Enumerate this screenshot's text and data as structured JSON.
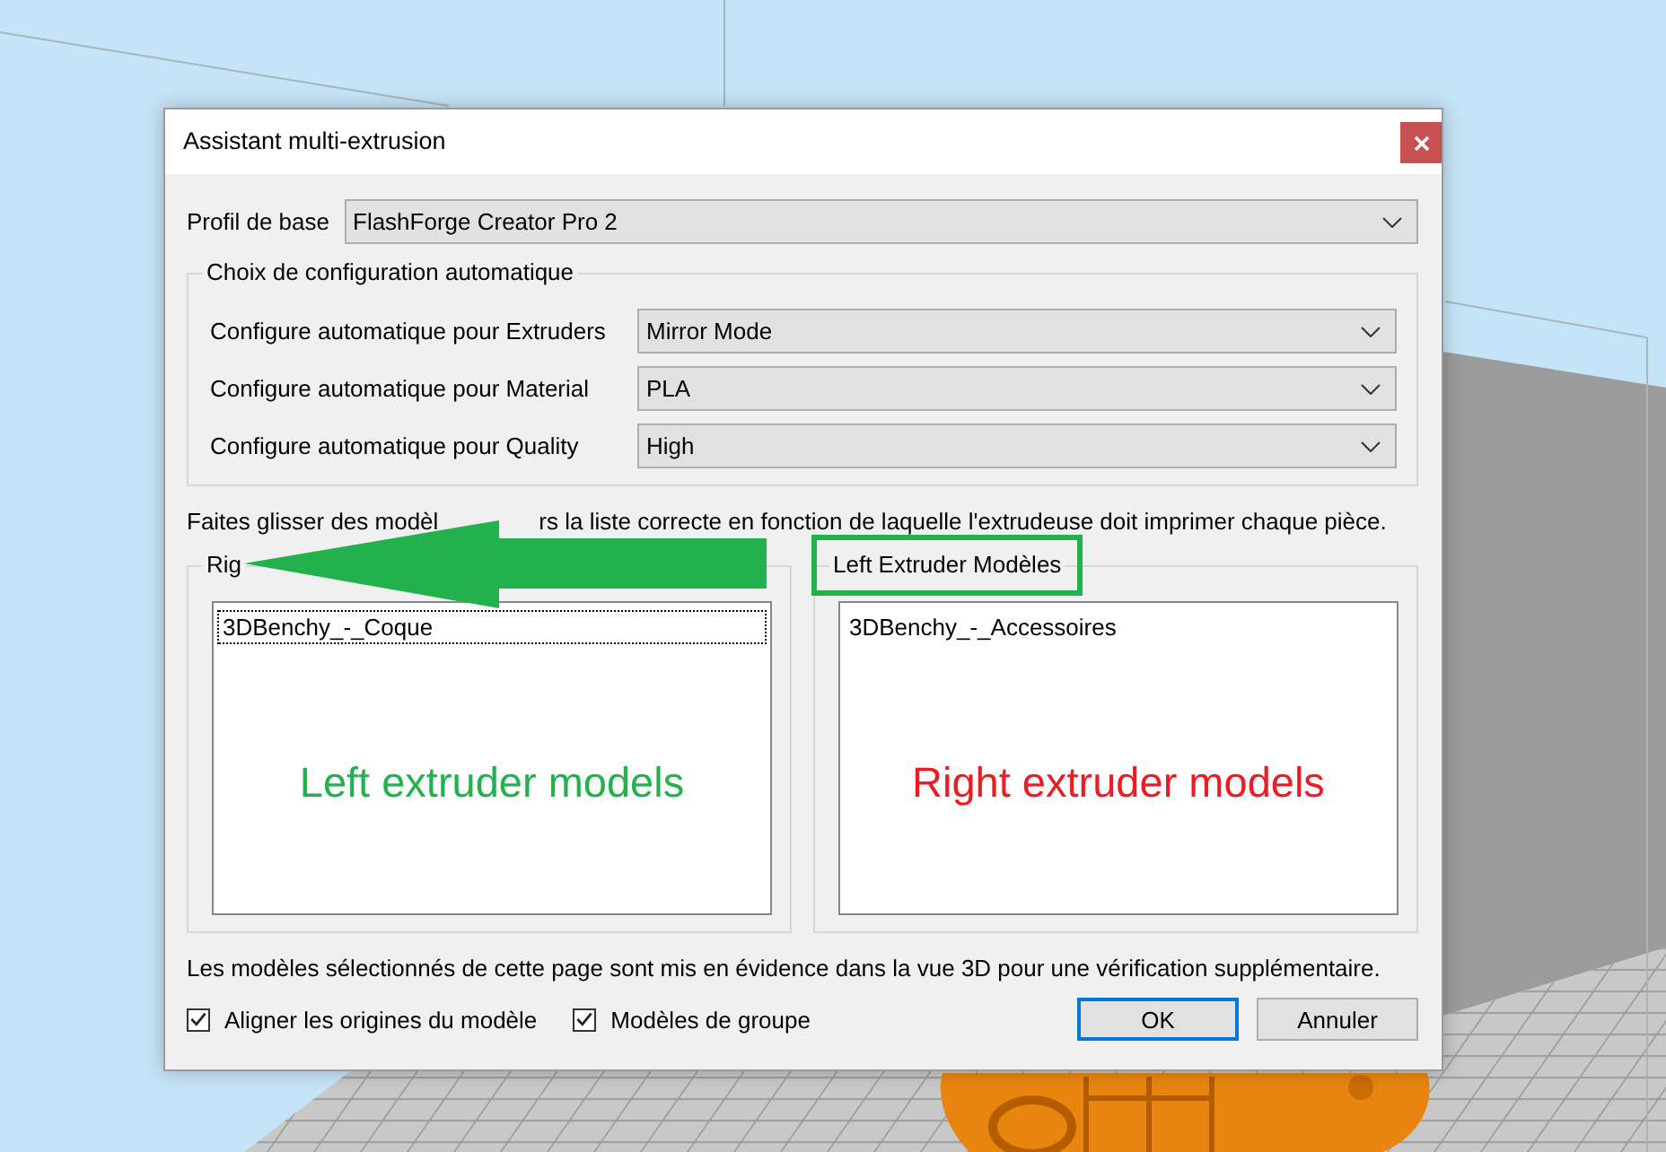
{
  "window": {
    "title": "Assistant multi-extrusion"
  },
  "base_profile": {
    "label": "Profil de base",
    "value": "FlashForge Creator Pro 2"
  },
  "auto_config": {
    "title": "Choix de configuration automatique",
    "rows": [
      {
        "label": "Configure automatique pour Extruders",
        "value": "Mirror Mode"
      },
      {
        "label": "Configure automatique pour Material",
        "value": "PLA"
      },
      {
        "label": "Configure automatique pour Quality",
        "value": "High"
      }
    ]
  },
  "instruction": [
    "Faites glisser des modèl",
    "rs la liste correcte en fonction de laquelle l'extrudeuse doit imprimer chaque pièce."
  ],
  "extruder_lists": [
    {
      "title": "Rig",
      "highlighted": false,
      "items": [
        {
          "label": "3DBenchy_-_Coque",
          "selected": false,
          "focused": true
        }
      ],
      "annotation": {
        "text": "Left extruder models",
        "color": "#22b14c"
      }
    },
    {
      "title": "Left Extruder Modèles",
      "highlighted": true,
      "items": [
        {
          "label": "3DBenchy_-_Accessoires",
          "selected": false,
          "focused": false
        }
      ],
      "annotation": {
        "text": "Right extruder models",
        "color": "#ed1c24"
      }
    }
  ],
  "note": "Les modèles sélectionnés de cette page sont mis en évidence dans la vue 3D pour une vérification supplémentaire.",
  "options": [
    {
      "label": "Aligner les origines du modèle",
      "checked": true
    },
    {
      "label": "Modèles de groupe",
      "checked": true
    }
  ],
  "buttons": [
    {
      "label": "OK",
      "default": true
    },
    {
      "label": "Annuler",
      "default": false
    }
  ]
}
